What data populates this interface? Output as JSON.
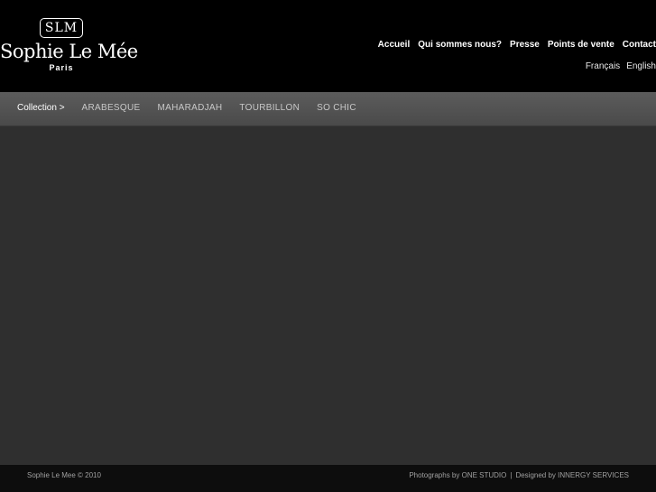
{
  "brand": {
    "monogram": "SLM",
    "name": "Sophie Le Mée",
    "city": "Paris"
  },
  "topnav": {
    "items": [
      "Accueil",
      "Qui sommes nous?",
      "Presse",
      "Points de vente",
      "Contact"
    ]
  },
  "languages": [
    "Français",
    "English"
  ],
  "subnav": {
    "crumb": "Collection >",
    "items": [
      "ARABESQUE",
      "MAHARADJAH",
      "TOURBILLON",
      "SO CHIC"
    ]
  },
  "footer": {
    "copyright": "Sophie Le Mee © 2010",
    "photo_credit": "Photographs by ONE STUDIO",
    "separator": "|",
    "design_credit": "Designed by INNERGY SERVICES"
  },
  "colors": {
    "header_bg": "#000000",
    "subnav_bg": "#555555",
    "content_bg": "#2f2f2f",
    "footer_bg": "#0d0d0d"
  }
}
